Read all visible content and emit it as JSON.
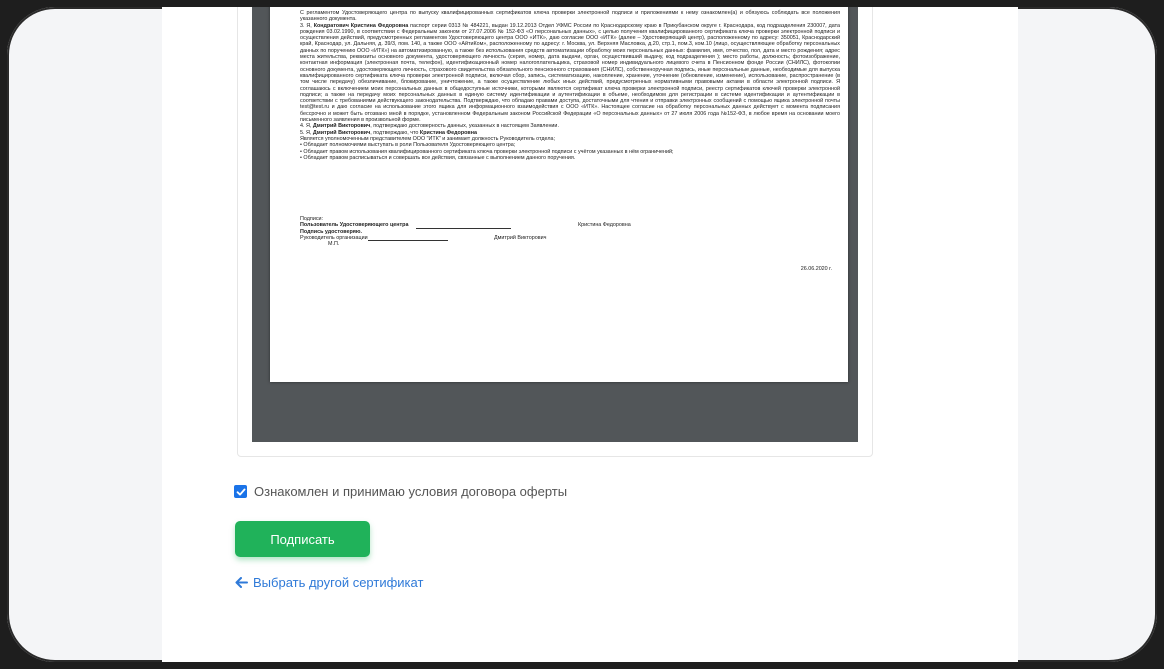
{
  "document": {
    "intro": "С регламентом Удостоверяющего центра по выпуску квалифицированных сертификатов ключа проверки электронной подписи и приложениями к нему ознакомлен(а) и обязуюсь соблюдать все положения указанного документа.",
    "para3_num": "3. Я,",
    "para3_name": "Кондратович Кристина Федоровна",
    "para3_text": "паспорт серии 0313 № 484221, выдан 19.12.2013 Отдел УФМС России по Краснодарскому краю в Прикубанском округе г. Краснодара, код подразделения 230007, дата рождения 03.02.1990, в соответствии с Федеральным законом от 27.07.2006 № 152-ФЗ «О персональных данных», с целью получения квалифицированного сертификата ключа проверки электронной подписи и осуществления действий, предусмотренных регламентом Удостоверяющего центра ООО «ИТК», даю согласие ООО «ИТК» (далее – Удостоверяющий центр), расположенному по адресу: 350051, Краснодарский край, Краснодар, ул. Дальняя, д. 39/3, пом. 140, а также ООО «АйтиКом», расположенному по адресу: г. Москва, ул. Верхняя Масловка, д.20, стр.1, пом.3, ком.10 (лицо, осуществляющее обработку персональных данных по поручению ООО «ИТК») на автоматизированную, а также без использования средств автоматизации обработку моих персональных данных: фамилия, имя, отчество, пол, дата и место рождения; адрес места жительства, реквизиты основного документа, удостоверяющего личность (серия, номер, дата выдачи, орган, осуществивший выдачу, код подразделения ); место работы, должность; фотоизображение, контактная информация (электронная почта, телефон), идентификационный номер налогоплательщика, страховой номер индивидуального лицевого счета в Пенсионном фонде России (СНИЛС), фотокопии основного документа, удостоверяющего личность, страхового свидетельства обязательного пенсионного страхования (СНИЛС), собственноручная подпись, иные персональные данные, необходимые для выпуска квалифицированного сертификата ключа проверки электронной подписи, включая сбор, запись, систематизацию, накопление, хранение, уточнение (обновление, изменение), использование, распространение (в том числе передачу) обезличивание, блокирование, уничтожение, а также осуществление любых иных действий, предусмотренных нормативными правовыми актами в области электронной подписи. Я соглашаюсь с включением моих персональных данных в общедоступные источники, которыми являются сертификат ключа проверки электронной подписи, реестр сертификатов ключей проверки электронной подписи; а также на передачу моих персональных данных в единую систему идентификации и аутентификации в объеме, необходимом для регистрации в системе идентификации и аутентификации в соответствии с требованиями действующего законодательства. Подтверждаю, что обладаю правами доступа, достаточными для чтения и отправки электронных сообщений с помощью ящика электронной почты test@test.ru и даю согласие на использование этого ящика для информационного взаимодействия с ООО «ИТК». Настоящее согласие на обработку персональных данных действует с момента подписания бессрочно и может быть отозвано мной в порядке, установленном Федеральным законом Российской Федерации «О персональных данных» от 27 июля 2006 года №152-ФЗ, в любое время на основании моего письменного заявления в произвольной форме.",
    "para4_num": "4. Я,",
    "para4_name": "Дмитрий Викторович",
    "para4_text": ", подтверждаю достоверность данных, указанных в настоящем Заявлении.",
    "para5_num": "5. Я,",
    "para5_name": "Дмитрий Викторович",
    "para5_text": ", подтверждаю, что",
    "para5_name2": "Кристина Федоровна",
    "para5_line2": "Является уполномоченным представителем ООО \"ИТК\" и занимает должность Руководитель отдела;",
    "bullets": [
      "• Обладает полномочиями выступать в роли Пользователя Удостоверяющего центра;",
      "• Обладает правом использования квалифицированного сертификата ключа проверки электронной подписи с учётом указанных в нём ограничений;",
      "• Обладает правом расписываться и совершать все действия, связанные с выполнением данного поручения."
    ],
    "signatures_label": "Подписи:",
    "user_label": "Пользователь Удостоверяющего центра",
    "user_name": "Кристина Федоровна",
    "confirmed_label": "Подпись удостоверяю.",
    "head_label": "Руководитель организации",
    "head_name": "Дмитрий Викторович",
    "stamp": "М.П.",
    "date": "26.06.2020 г."
  },
  "consent": {
    "checked": true,
    "label": "Ознакомлен и принимаю условия договора оферты"
  },
  "sign_button": "Подписать",
  "back_link": "Выбрать другой сертификат",
  "colors": {
    "accent_green": "#20b25a",
    "link_blue": "#2f7ad8",
    "viewer_gray": "#525659"
  }
}
